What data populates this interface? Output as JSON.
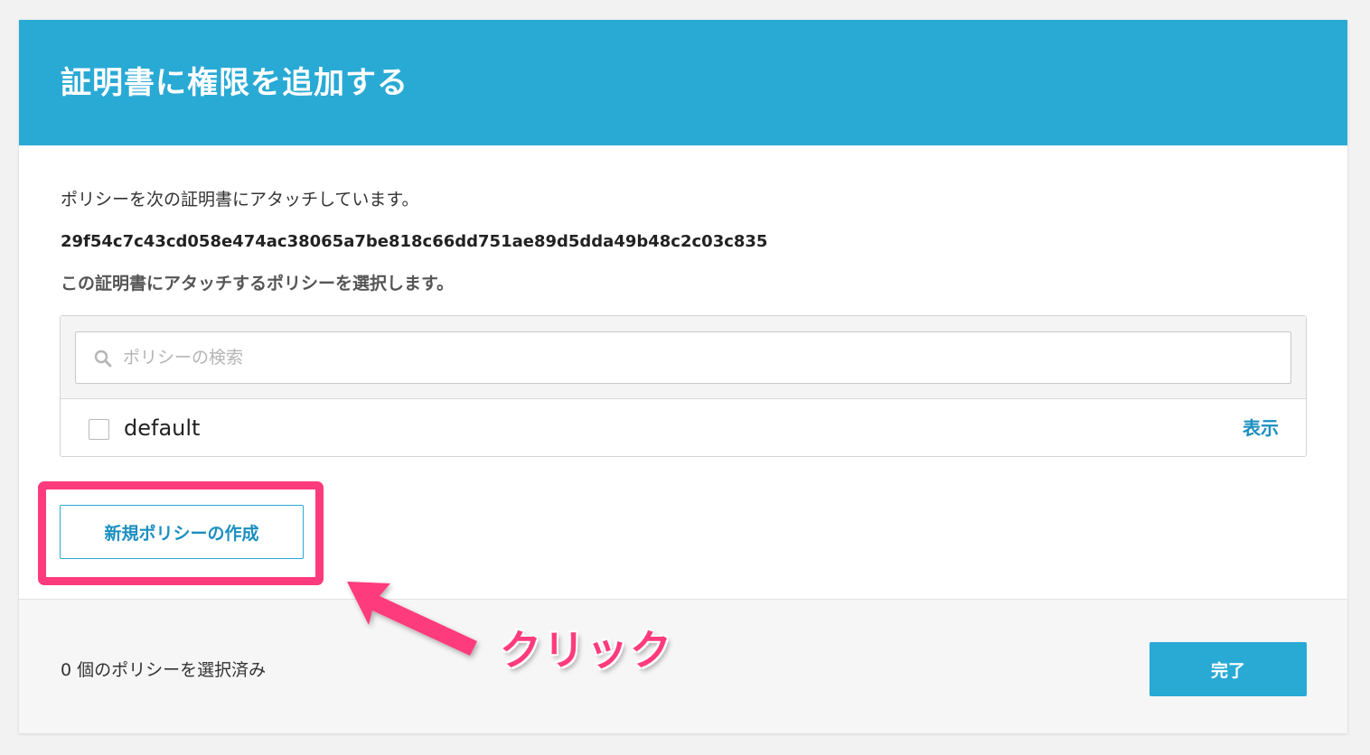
{
  "dialog": {
    "title": "証明書に権限を追加する",
    "intro_text": "ポリシーを次の証明書にアタッチしています。",
    "certificate_id": "29f54c7c43cd058e474ac38065a7be818c66dd751ae89d5dda49b48c2c03c835",
    "select_label": "この証明書にアタッチするポリシーを選択します。"
  },
  "search": {
    "placeholder": "ポリシーの検索",
    "value": ""
  },
  "policies": [
    {
      "name": "default",
      "checked": false,
      "view_label": "表示"
    }
  ],
  "buttons": {
    "new_policy_label": "新規ポリシーの作成",
    "done_label": "完了"
  },
  "footer": {
    "selected_count_text": "0 個のポリシーを選択済み"
  },
  "annotation": {
    "text": "クリック"
  },
  "colors": {
    "header_bg": "#29aad5",
    "link": "#1b8fc0",
    "annotation": "#fe3b7d"
  }
}
